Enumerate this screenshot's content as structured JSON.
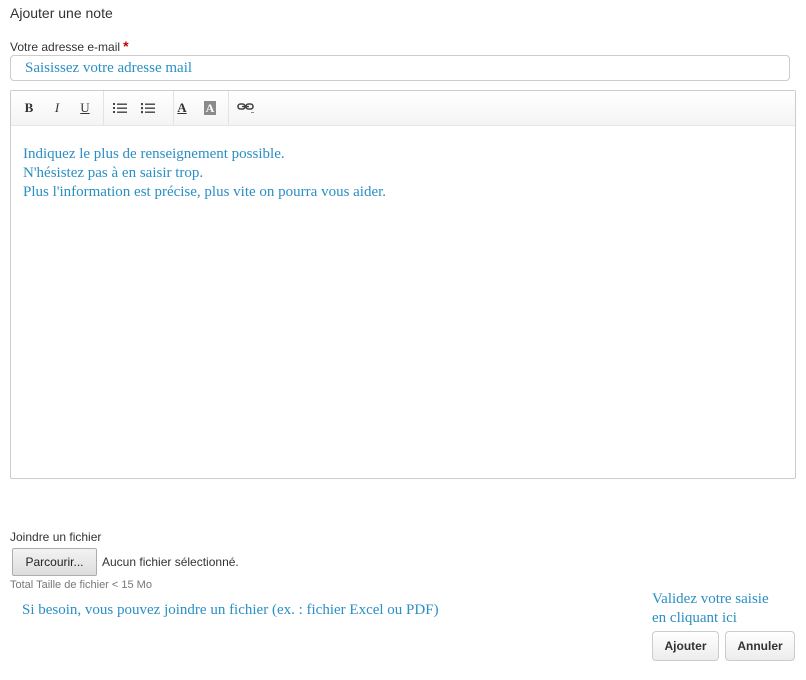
{
  "page": {
    "title": "Ajouter une note"
  },
  "email": {
    "label": "Votre adresse e-mail",
    "required_mark": "*",
    "hint": "Saisissez votre adresse mail"
  },
  "editor": {
    "toolbar": [
      {
        "name": "bold",
        "glyph": "B"
      },
      {
        "name": "italic",
        "glyph": "I"
      },
      {
        "name": "underline",
        "glyph": "U"
      },
      {
        "name": "bulleted-list",
        "icon": "bullet-list-icon"
      },
      {
        "name": "numbered-list",
        "icon": "numbered-list-icon"
      },
      {
        "name": "text-color",
        "glyph": "A"
      },
      {
        "name": "background-color",
        "glyph": "A"
      },
      {
        "name": "link",
        "icon": "link-icon"
      }
    ],
    "lines": [
      "Indiquez le plus de renseignement possible.",
      "N'hésistez pas à en saisir trop.",
      "Plus l'information est précise, plus vite on pourra vous aider."
    ]
  },
  "attachment": {
    "label": "Joindre un fichier",
    "browse_label": "Parcourir...",
    "status": "Aucun fichier sélectionné.",
    "size_note": "Total Taille de fichier < 15 Mo",
    "hint": "Si besoin, vous pouvez joindre un fichier (ex. : fichier Excel ou PDF)"
  },
  "actions": {
    "validate_hint_line1": "Validez votre saisie",
    "validate_hint_line2": "en cliquant ici",
    "add_label": "Ajouter",
    "cancel_label": "Annuler"
  },
  "colors": {
    "hint_blue": "#2a8fc4",
    "required_red": "#cc0000"
  }
}
